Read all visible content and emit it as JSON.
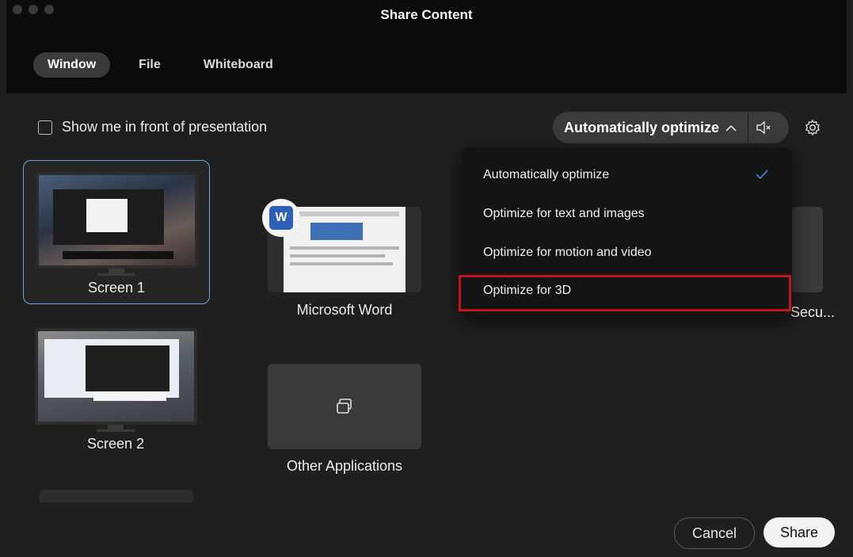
{
  "window": {
    "title": "Share Content"
  },
  "tabs": [
    {
      "label": "Window",
      "active": true
    },
    {
      "label": "File",
      "active": false
    },
    {
      "label": "Whiteboard",
      "active": false
    }
  ],
  "options": {
    "show_me_label": "Show me in front of presentation",
    "show_me_checked": false
  },
  "optimize": {
    "selected": "Automatically optimize",
    "menu": [
      {
        "label": "Automatically optimize",
        "checked": true
      },
      {
        "label": "Optimize for text and images",
        "checked": false
      },
      {
        "label": "Optimize for motion and video",
        "checked": false
      },
      {
        "label": "Optimize for 3D",
        "checked": false,
        "highlighted": true
      }
    ]
  },
  "screens": [
    {
      "label": "Screen 1",
      "selected": true
    },
    {
      "label": "Screen 2",
      "selected": false
    }
  ],
  "apps": [
    {
      "label": "Microsoft Word",
      "icon": "word-icon"
    },
    {
      "label": "Other Applications",
      "icon": "windows-stack-icon"
    },
    {
      "label": "Secu...",
      "icon": ""
    }
  ],
  "buttons": {
    "cancel": "Cancel",
    "share": "Share"
  },
  "colors": {
    "accent_blue": "#6aa6e6",
    "highlight_red": "#c4141b"
  }
}
